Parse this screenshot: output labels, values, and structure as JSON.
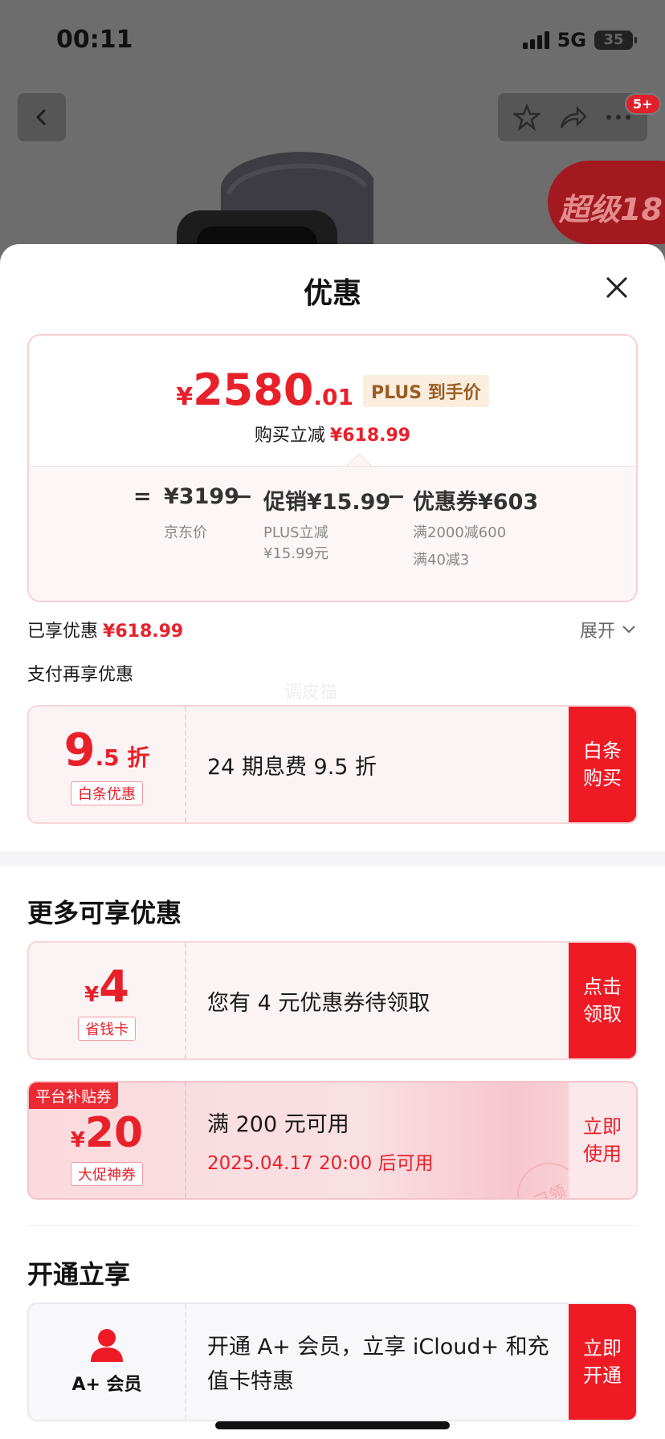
{
  "status_bar": {
    "time": "00:11",
    "network": "5G",
    "battery": "35"
  },
  "header": {
    "badge_count": "5+",
    "promo_text": "超级18"
  },
  "sheet": {
    "title": "优惠"
  },
  "price_card": {
    "currency": "¥",
    "price_int": "2580",
    "price_dec": ".01",
    "plus_tag": "PLUS 到手价",
    "reduce_label": "购买立减",
    "reduce_amount": "¥618.99",
    "equals": "=",
    "jd_price": "¥3199",
    "jd_label": "京东价",
    "minus1": "−",
    "promo_label": "促销¥15.99",
    "promo_sub1": "PLUS立减",
    "promo_sub2": "¥15.99元",
    "minus2": "−",
    "coupon_label": "优惠券¥603",
    "coupon_sub1": "满2000减600",
    "coupon_sub2": "满40减3"
  },
  "enjoyed": {
    "label": "已享优惠",
    "amount": "¥618.99",
    "expand": "展开"
  },
  "pay_more_title": "支付再享优惠",
  "watermark": "调皮猫",
  "baitiao": {
    "big": "9",
    "small": ".5 折",
    "tag": "白条优惠",
    "text": "24 期息费 9.5 折",
    "action": "白条购买"
  },
  "more_title": "更多可享优惠",
  "saving_card": {
    "currency": "¥",
    "value": "4",
    "tag": "省钱卡",
    "text": "您有 4 元优惠券待领取",
    "action": "点击领取"
  },
  "platform_coupon": {
    "corner": "平台补贴券",
    "currency": "¥",
    "value": "20",
    "tag": "大促神券",
    "text": "满 200 元可用",
    "sub": "2025.04.17 20:00 后可用",
    "action": "立即使用",
    "stamp": "已领"
  },
  "open_title": "开通立享",
  "member": {
    "label": "A+ 会员",
    "text1": "开通 A+ 会员，立享 iCloud+ 和充",
    "text2": "值卡特惠",
    "action": "立即开通"
  },
  "colors": {
    "accent": "#e8202a",
    "action_red": "#ee1a24",
    "plus_gold": "#9a5d23"
  }
}
